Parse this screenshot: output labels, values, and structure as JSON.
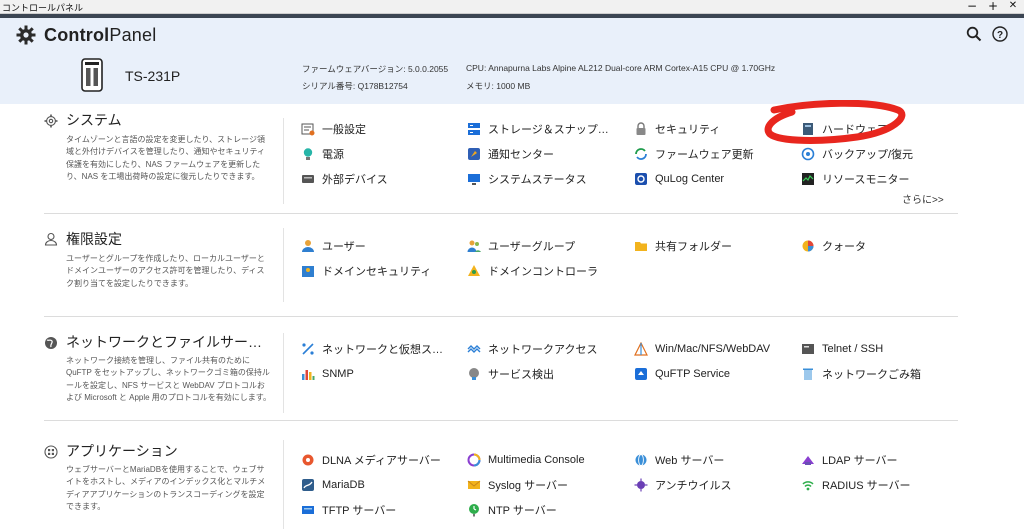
{
  "window": {
    "title": "コントロールパネル",
    "controls": [
      "−",
      "+",
      "✕"
    ]
  },
  "header": {
    "app_name_bold": "Control",
    "app_name_rest": "Panel",
    "device_name": "TS-231P",
    "firmware": "ファームウェアバージョン: 5.0.0.2055",
    "serial": "シリアル番号: Q178B12754",
    "cpu": "CPU: Annapurna Labs Alpine AL212 Dual-core ARM Cortex-A15 CPU @ 1.70GHz",
    "memory": "メモリ: 1000 MB",
    "icons": [
      "search-icon",
      "help-icon"
    ]
  },
  "sections": [
    {
      "title": "システム",
      "icon": "gear-icon",
      "desc": "タイムゾーンと言語の設定を変更したり、ストレージ領域と外付けデバイスを管理したり、通知やセキュリティ保護を有効にしたり、NAS ファームウェアを更新したり、NAS を工場出荷時の設定に復元したりできます。",
      "items": [
        "一般設定",
        "ストレージ＆スナップショット",
        "セキュリティ",
        "ハードウェア",
        "電源",
        "通知センター",
        "ファームウェア更新",
        "バックアップ/復元",
        "外部デバイス",
        "システムステータス",
        "QuLog Center",
        "リソースモニター"
      ],
      "more": "さらに>>"
    },
    {
      "title": "権限設定",
      "icon": "user-icon",
      "desc": "ユーザーとグループを作成したり、ローカルユーザーとドメインユーザーのアクセス許可を管理したり、ディスク割り当てを設定したりできます。",
      "items": [
        "ユーザー",
        "ユーザーグループ",
        "共有フォルダー",
        "クォータ",
        "ドメインセキュリティ",
        "ドメインコントローラ"
      ]
    },
    {
      "title": "ネットワークとファイルサービス",
      "icon": "globe-icon",
      "desc": "ネットワーク接続を管理し、ファイル共有のために QuFTP をセットアップし、ネットワークゴミ箱の保持ルールを設定し、NFS サービスと WebDAV プロトコルおよび Microsoft と Apple 用のプロトコルを有効にします。",
      "items": [
        "ネットワークと仮想スイッチ",
        "ネットワークアクセス",
        "Win/Mac/NFS/WebDAV",
        "Telnet / SSH",
        "SNMP",
        "サービス検出",
        "QuFTP Service",
        "ネットワークごみ箱"
      ]
    },
    {
      "title": "アプリケーション",
      "icon": "apps-icon",
      "desc": "ウェブサーバーとMariaDBを使用することで、ウェブサイトをホストし、メディアのインデックス化とマルチメディアアプリケーションのトランスコーディングを設定できます。",
      "items": [
        "DLNA メディアサーバー",
        "Multimedia Console",
        "Web サーバー",
        "LDAP サーバー",
        "MariaDB",
        "Syslog サーバー",
        "アンチウイルス",
        "RADIUS サーバー",
        "TFTP サーバー",
        "NTP サーバー"
      ]
    }
  ],
  "colors": {
    "header_bg": "#e9f0fa",
    "accent_red": "#e8261e",
    "qnap_blue": "#1b6ed8"
  }
}
